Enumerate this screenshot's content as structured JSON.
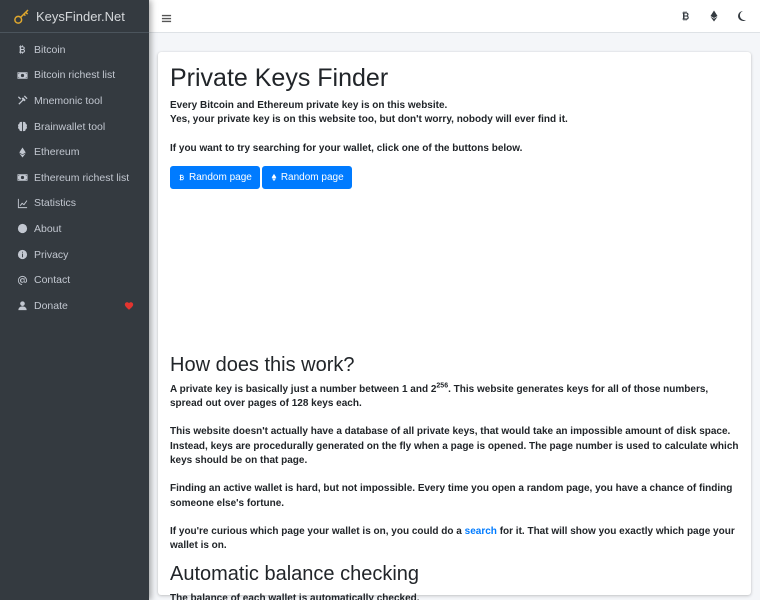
{
  "brand": {
    "name": "KeysFinder.Net"
  },
  "sidebar": {
    "items": [
      {
        "label": "Bitcoin",
        "icon": "bitcoin-icon"
      },
      {
        "label": "Bitcoin richest list",
        "icon": "money-bill-icon"
      },
      {
        "label": "Mnemonic tool",
        "icon": "tools-icon"
      },
      {
        "label": "Brainwallet tool",
        "icon": "brain-icon"
      },
      {
        "label": "Ethereum",
        "icon": "ethereum-icon"
      },
      {
        "label": "Ethereum richest list",
        "icon": "money-bill-icon"
      },
      {
        "label": "Statistics",
        "icon": "chart-line-icon"
      },
      {
        "label": "About",
        "icon": "circle-icon"
      },
      {
        "label": "Privacy",
        "icon": "info-circle-icon"
      },
      {
        "label": "Contact",
        "icon": "at-icon"
      },
      {
        "label": "Donate",
        "icon": "user-icon"
      }
    ],
    "donate_heart_color": "#e3342f"
  },
  "topbar": {
    "icons": [
      "menu-icon",
      "bitcoin-icon",
      "ethereum-icon",
      "moon-icon"
    ]
  },
  "main": {
    "title": "Private Keys Finder",
    "intro_line1": "Every Bitcoin and Ethereum private key is on this website.",
    "intro_line2": "Yes, your private key is on this website too, but don't worry, nobody will ever find it.",
    "intro_line3": "If you want to try searching for your wallet, click one of the buttons below.",
    "btn_bitcoin": "Random page",
    "btn_ethereum": "Random page",
    "how_title": "How does this work?",
    "how_p1_a": "A private key is basically just a number between 1 and 2",
    "how_p1_sup": "256",
    "how_p1_b": ". This website generates keys for all of those numbers, spread out over pages of 128 keys each.",
    "how_p2": "This website doesn't actually have a database of all private keys, that would take an impossible amount of disk space. Instead, keys are procedurally generated on the fly when a page is opened. The page number is used to calculate which keys should be on that page.",
    "how_p3": "Finding an active wallet is hard, but not impossible. Every time you open a random page, you have a chance of finding someone else's fortune.",
    "how_p4_a": "If you're curious which page your wallet is on, you could do a",
    "how_p4_link": "search",
    "how_p4_b": "for it. That will show you exactly which page your wallet is on.",
    "auto_title": "Automatic balance checking",
    "auto_p1": "The balance of each wallet is automatically checked."
  },
  "colors": {
    "sidebar_bg": "#343a40",
    "accent": "#007bff",
    "page_bg": "#f4f6f9"
  }
}
